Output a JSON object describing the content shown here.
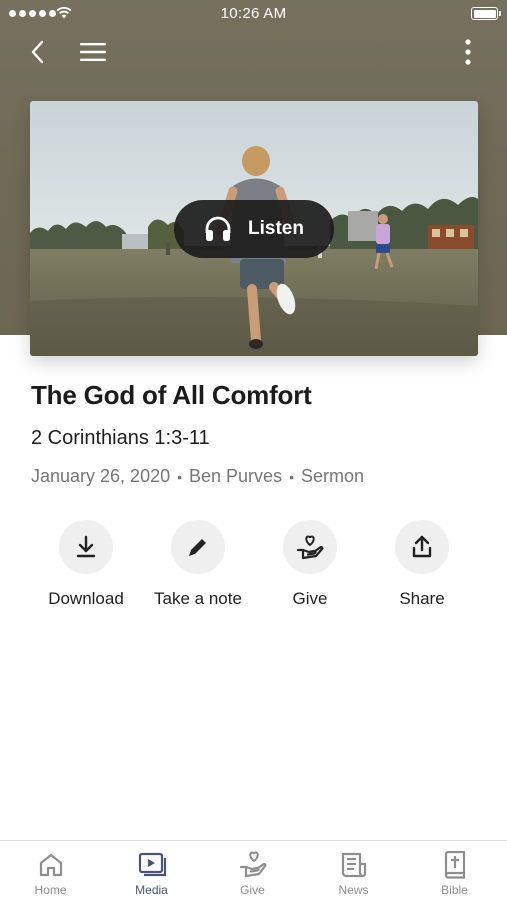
{
  "status_bar": {
    "time": "10:26 AM",
    "battery_level": 1.0
  },
  "nav": {
    "back_icon": "chevron-left-icon",
    "menu_icon": "hamburger-icon",
    "more_icon": "more-vertical-icon"
  },
  "hero": {
    "listen_label": "Listen",
    "listen_icon": "headphones-icon"
  },
  "sermon": {
    "title": "The God of All Comfort",
    "passage": "2 Corinthians 1:3-11",
    "date": "January 26, 2020",
    "speaker": "Ben Purves",
    "type": "Sermon",
    "separator": "•"
  },
  "actions": [
    {
      "label": "Download",
      "icon": "download-icon"
    },
    {
      "label": "Take a note",
      "icon": "pencil-icon"
    },
    {
      "label": "Give",
      "icon": "give-hand-heart-icon"
    },
    {
      "label": "Share",
      "icon": "share-icon"
    }
  ],
  "tabs": [
    {
      "label": "Home",
      "icon": "home-icon",
      "active": false
    },
    {
      "label": "Media",
      "icon": "media-icon",
      "active": true
    },
    {
      "label": "Give",
      "icon": "give-icon",
      "active": false
    },
    {
      "label": "News",
      "icon": "news-icon",
      "active": false
    },
    {
      "label": "Bible",
      "icon": "bible-icon",
      "active": false
    }
  ],
  "colors": {
    "header_bg": "#6f6a56",
    "active_tab": "#4a5576",
    "inactive_tab": "#8e8e8e",
    "action_circle": "#efefef"
  }
}
